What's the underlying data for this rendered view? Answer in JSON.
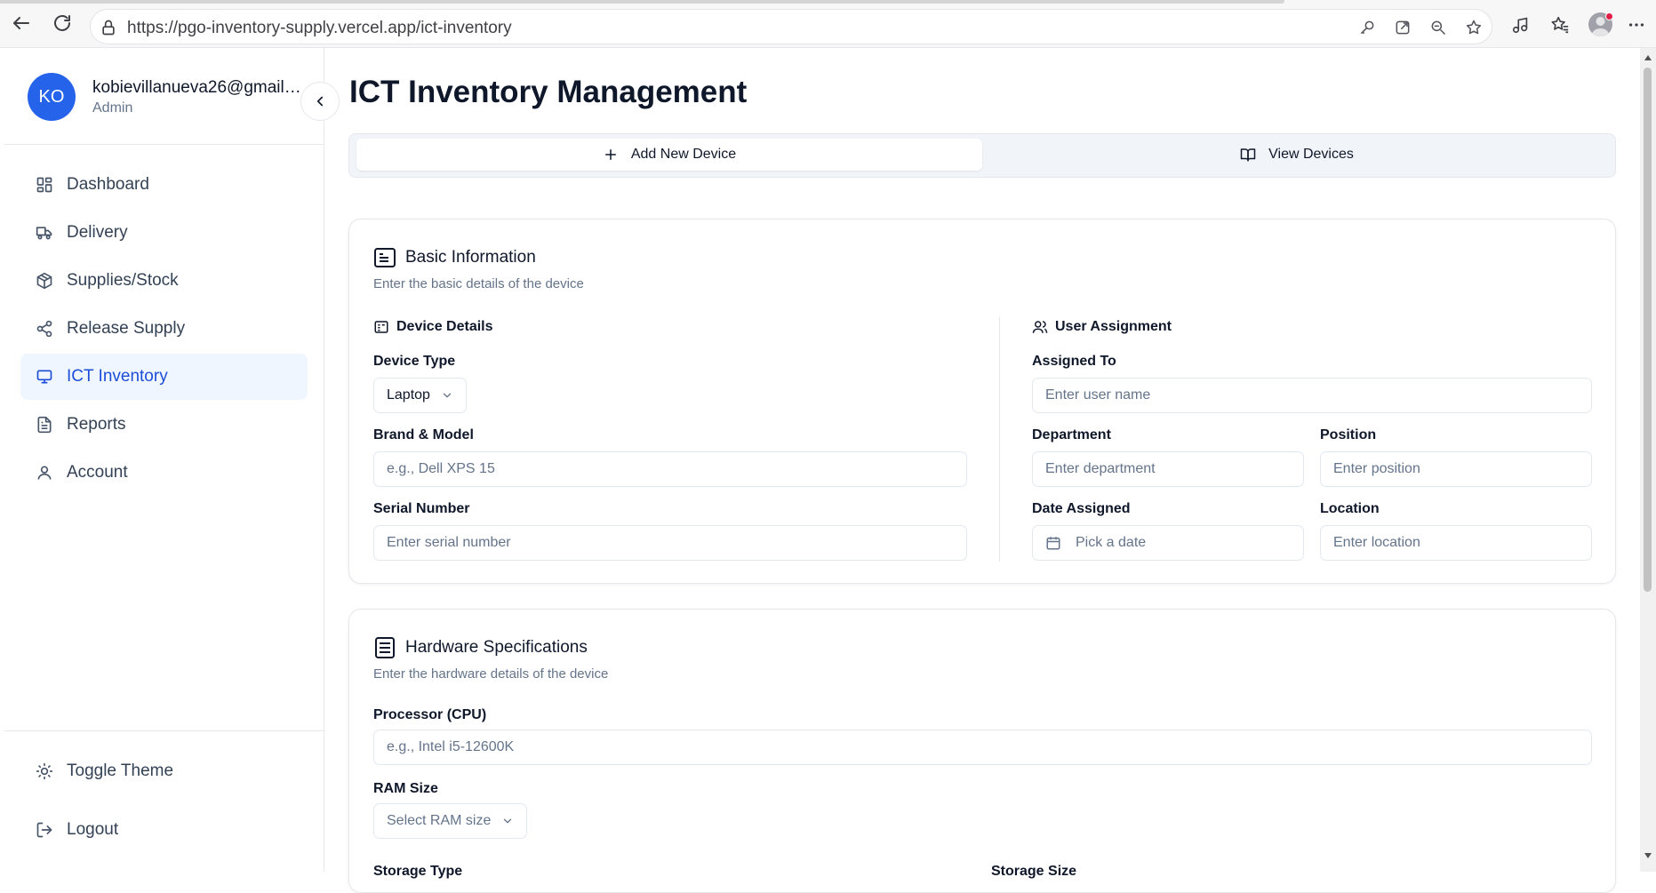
{
  "browser": {
    "url": "https://pgo-inventory-supply.vercel.app/ict-inventory"
  },
  "sidebar": {
    "user": {
      "initials": "KO",
      "email": "kobievillanueva26@gmail....",
      "role": "Admin"
    },
    "items": [
      {
        "label": "Dashboard",
        "icon": "dashboard-icon",
        "active": false
      },
      {
        "label": "Delivery",
        "icon": "truck-icon",
        "active": false
      },
      {
        "label": "Supplies/Stock",
        "icon": "box-icon",
        "active": false
      },
      {
        "label": "Release Supply",
        "icon": "share-icon",
        "active": false
      },
      {
        "label": "ICT Inventory",
        "icon": "monitor-icon",
        "active": true
      },
      {
        "label": "Reports",
        "icon": "file-icon",
        "active": false
      },
      {
        "label": "Account",
        "icon": "user-icon",
        "active": false
      }
    ],
    "footer": {
      "toggle_theme": "Toggle Theme",
      "logout": "Logout"
    }
  },
  "main": {
    "title": "ICT Inventory Management",
    "tabs": {
      "add": "Add New Device",
      "view": "View Devices"
    },
    "basic": {
      "title": "Basic Information",
      "description": "Enter the basic details of the device",
      "device_details": {
        "heading": "Device Details",
        "device_type_label": "Device Type",
        "device_type_value": "Laptop",
        "brand_label": "Brand & Model",
        "brand_placeholder": "e.g., Dell XPS 15",
        "serial_label": "Serial Number",
        "serial_placeholder": "Enter serial number"
      },
      "user_assignment": {
        "heading": "User Assignment",
        "assigned_label": "Assigned To",
        "assigned_placeholder": "Enter user name",
        "department_label": "Department",
        "department_placeholder": "Enter department",
        "position_label": "Position",
        "position_placeholder": "Enter position",
        "date_label": "Date Assigned",
        "date_placeholder": "Pick a date",
        "location_label": "Location",
        "location_placeholder": "Enter location"
      }
    },
    "hardware": {
      "title": "Hardware Specifications",
      "description": "Enter the hardware details of the device",
      "cpu_label": "Processor (CPU)",
      "cpu_placeholder": "e.g., Intel i5-12600K",
      "ram_label": "RAM Size",
      "ram_placeholder": "Select RAM size",
      "storage_type_label": "Storage Type",
      "storage_size_label": "Storage Size"
    }
  },
  "colors": {
    "accent": "#2563eb",
    "active_bg": "#eff6ff",
    "active_text": "#1d4ed8"
  }
}
